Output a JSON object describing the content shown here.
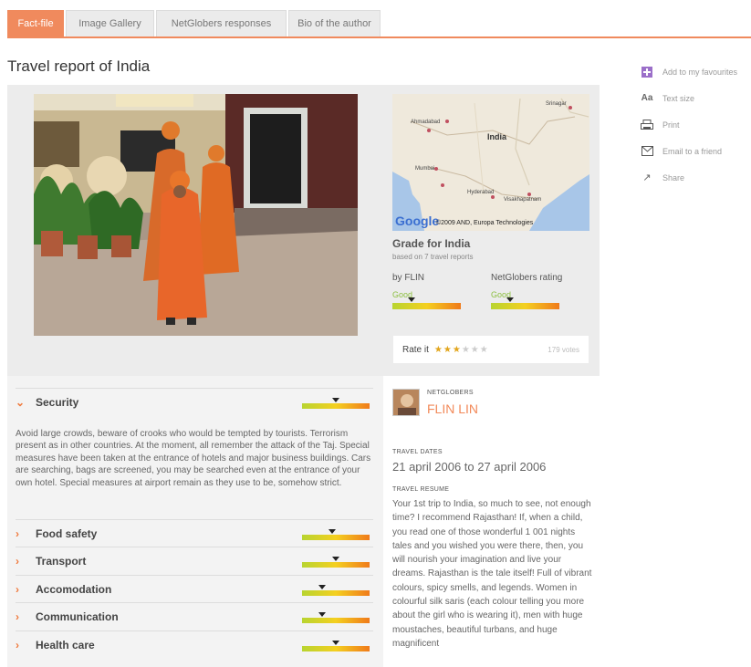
{
  "tabs": [
    {
      "label": "Fact-file",
      "active": true
    },
    {
      "label": "Image Gallery",
      "active": false
    },
    {
      "label": "NetGlobers responses",
      "active": false
    },
    {
      "label": "Bio of the author",
      "active": false
    }
  ],
  "page_title": "Travel report of India",
  "side_tools": [
    {
      "label": "Add to my favourites",
      "icon": "favourite-icon"
    },
    {
      "label": "Text size",
      "icon": "text-size-icon"
    },
    {
      "label": "Print",
      "icon": "print-icon"
    },
    {
      "label": "Email to a friend",
      "icon": "email-icon"
    },
    {
      "label": "Share",
      "icon": "share-icon"
    }
  ],
  "map": {
    "attribution": "©2009 AND, Europa Technologies",
    "logo": "Google",
    "places": [
      "India",
      "Ahmadabad",
      "Mumbai",
      "Hyderabad",
      "Visakhapatnam",
      "Srinagar"
    ]
  },
  "grade": {
    "title": "Grade for India",
    "subtitle": "based on 7 travel reports",
    "by_author": {
      "label": "by FLIN",
      "value": "Good",
      "level": 0.28
    },
    "netglobers": {
      "label": "NetGlobers rating",
      "value": "Good",
      "level": 0.28
    }
  },
  "rate": {
    "label": "Rate it",
    "stars": 3,
    "max": 6,
    "votes": "179 votes"
  },
  "sections": [
    {
      "name": "Security",
      "expanded": true,
      "level": 0.5
    },
    {
      "name": "Food safety",
      "expanded": false,
      "level": 0.45
    },
    {
      "name": "Transport",
      "expanded": false,
      "level": 0.5
    },
    {
      "name": "Accomodation",
      "expanded": false,
      "level": 0.3
    },
    {
      "name": "Communication",
      "expanded": false,
      "level": 0.3
    },
    {
      "name": "Health care",
      "expanded": false,
      "level": 0.5
    }
  ],
  "security_text": "Avoid large crowds, beware of crooks who would be tempted by tourists. Terrorism present as in other countries. At the moment, all remember the attack of the Taj. Special measures have been taken at the entrance of hotels and major business buildings. Cars are searching, bags are screened, you may be searched even at the entrance of your own hotel. Special measures at airport remain as they use to be, somehow strict.",
  "author": {
    "member_type": "NETGLOBERS",
    "name": "FLIN LIN"
  },
  "travel_dates": {
    "label": "TRAVEL DATES",
    "value": "21 april 2006 to 27 april 2006"
  },
  "travel_resume": {
    "label": "TRAVEL RESUME",
    "text": "Your 1st trip to India, so much to see, not enough time? I recommend Rajasthan! If, when a child, you read one of those wonderful 1 001 nights tales and you wished you were there, then, you will nourish your imagination and live your dreams. Rajasthan is the tale itself! Full of vibrant colours, spicy smells, and legends. Women in colourful silk saris (each colour telling you more about the girl who is wearing it), men with huge moustaches, beautiful turbans, and huge magnificent"
  },
  "colors": {
    "accent": "#f08a5d",
    "good": "#8cbf3f",
    "star": "#e2a51c"
  }
}
